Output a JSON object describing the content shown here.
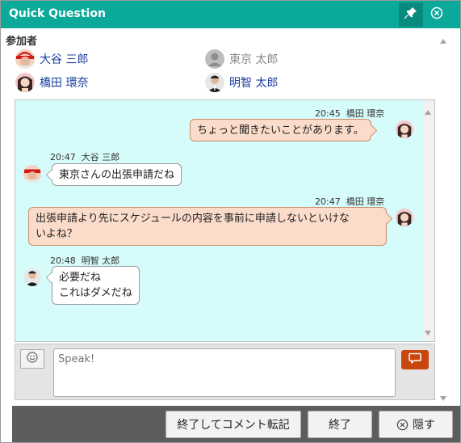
{
  "window": {
    "title": "Quick Question"
  },
  "participants": {
    "label": "参加者",
    "items": [
      {
        "name": "大谷 三郎",
        "online": true,
        "avatar": "baseball-cap-player"
      },
      {
        "name": "東京 太郎",
        "online": false,
        "avatar": "default-person"
      },
      {
        "name": "橋田 環奈",
        "online": true,
        "avatar": "woman"
      },
      {
        "name": "明智 太郎",
        "online": true,
        "avatar": "man-suit"
      }
    ]
  },
  "messages": [
    {
      "side": "right",
      "time": "20:45",
      "sender": "橋田 環奈",
      "text": "ちょっと聞きたいことがあります。"
    },
    {
      "side": "left",
      "time": "20:47",
      "sender": "大谷 三郎",
      "text": "東京さんの出張申請だね"
    },
    {
      "side": "right",
      "time": "20:47",
      "sender": "橋田 環奈",
      "text": "出張申請より先にスケジュールの内容を事前に申請しないといけな\nいよね？"
    },
    {
      "side": "left",
      "time": "20:48",
      "sender": "明智 太郎",
      "text": "必要だね\nこれはダメだね"
    }
  ],
  "input": {
    "placeholder": "Speak!"
  },
  "footer": {
    "end_with_transfer": "終了してコメント転記",
    "end": "終了",
    "hide": "隠す"
  },
  "colors": {
    "title_bar": "#0ba99a",
    "chat_bg": "#d5fbfa",
    "my_bubble": "#fbdccb",
    "send_button": "#c9460c"
  }
}
